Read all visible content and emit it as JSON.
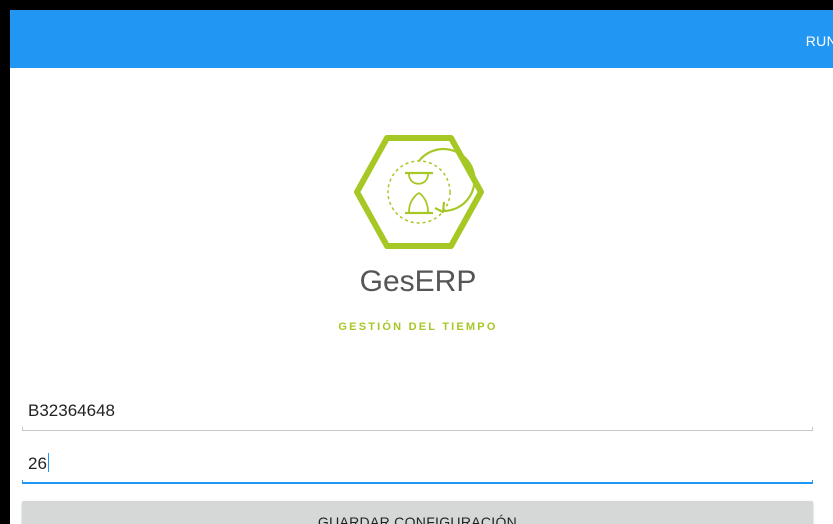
{
  "app": {
    "toolbar_action": "RUN"
  },
  "logo": {
    "icon_name": "hourglass-hexagon-icon",
    "name": "GesERP",
    "tagline": "GESTIÓN DEL TIEMPO",
    "accent_color": "#a6c825"
  },
  "form": {
    "company_field_value": "B32364648",
    "code_field_value": "26",
    "save_button_label": "GUARDAR CONFIGURACIÓN"
  },
  "colors": {
    "appbar": "#2196f3",
    "button": "#d6d7d7"
  }
}
